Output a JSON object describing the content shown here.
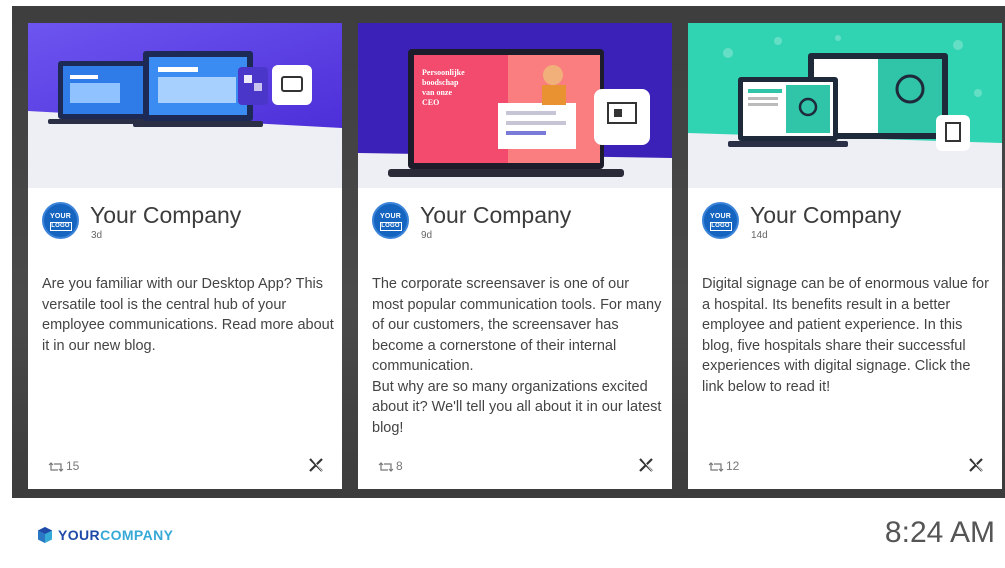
{
  "posts": [
    {
      "company": "Your Company",
      "age": "3d",
      "text": "Are you familiar with our Desktop App? This versatile tool is the central hub of your employee communications. Read more about it in our new blog.",
      "retweets": "15",
      "logo_line1": "YOUR",
      "logo_line2": "LOGO",
      "hero_text": "",
      "hero_color": "#6a4fe8"
    },
    {
      "company": "Your Company",
      "age": "9d",
      "text": "The corporate screensaver is one of our most popular communication tools. For many of our customers, the screensaver has become a cornerstone of their internal communication.\nBut why are so many organizations excited about it? We'll tell you all about it in our latest blog!",
      "retweets": "8",
      "logo_line1": "YOUR",
      "logo_line2": "LOGO",
      "hero_text": "Persoonlijke boodschap van onze CEO",
      "hero_color": "#3b21b8"
    },
    {
      "company": "Your Company",
      "age": "14d",
      "text": "Digital signage can be of enormous value for a hospital. Its benefits result in a better employee and patient experience. In this blog, five hospitals share their successful experiences with digital signage. Click the link below to read it!",
      "retweets": "12",
      "logo_line1": "YOUR",
      "logo_line2": "LOGO",
      "hero_text": "",
      "hero_color": "#2fd3b0"
    }
  ],
  "footer": {
    "brand_your": "YOUR",
    "brand_company": "COMPANY",
    "clock": "8:24 AM"
  },
  "icons": {
    "retweet": "retweet-icon",
    "x_logo": "x-logo-icon",
    "brand_logo": "brand-logo-icon"
  },
  "colors": {
    "brand_dark": "#1f4aa8",
    "brand_light": "#36a9d6",
    "frame": "#444444"
  }
}
